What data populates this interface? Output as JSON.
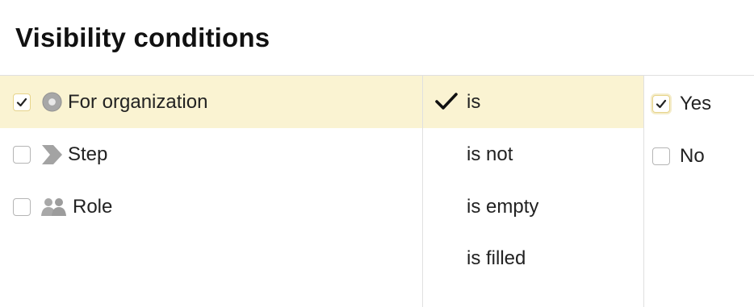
{
  "title": "Visibility conditions",
  "fields": [
    {
      "label": "For organization",
      "icon": "organization-icon",
      "checked": true,
      "selected": true
    },
    {
      "label": "Step",
      "icon": "step-icon",
      "checked": false,
      "selected": false
    },
    {
      "label": "Role",
      "icon": "role-icon",
      "checked": false,
      "selected": false
    }
  ],
  "operators": [
    {
      "label": "is",
      "selected": true
    },
    {
      "label": "is not",
      "selected": false
    },
    {
      "label": "is empty",
      "selected": false
    },
    {
      "label": "is filled",
      "selected": false
    }
  ],
  "values": [
    {
      "label": "Yes",
      "checked": true
    },
    {
      "label": "No",
      "checked": false
    }
  ],
  "colors": {
    "selected_row": "#faf3d2",
    "checked_border": "#e7d48a",
    "divider": "#e0e0e0"
  }
}
